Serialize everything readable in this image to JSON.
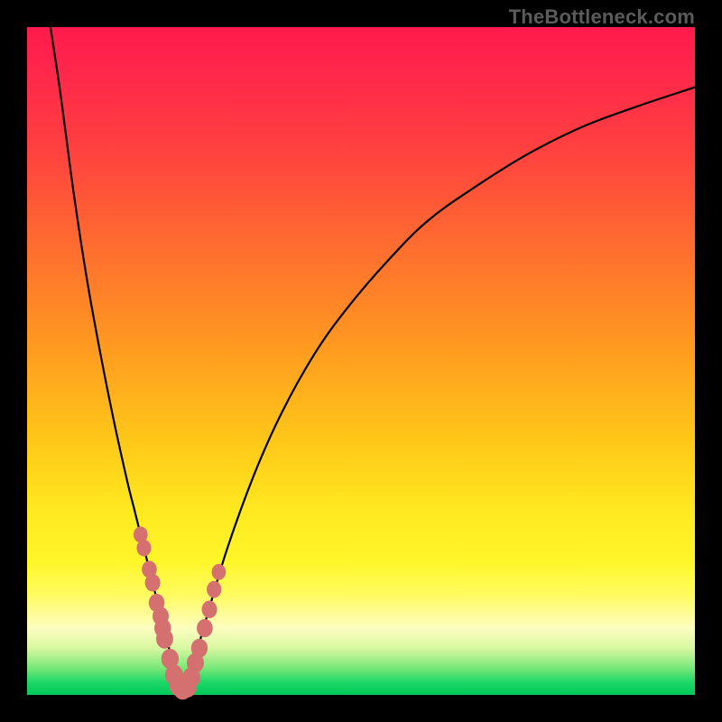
{
  "watermark": "TheBottleneck.com",
  "colors": {
    "background": "#000000",
    "curve": "#000000",
    "bead": "#d47070",
    "gradient_top": "#ff1a4d",
    "gradient_bottom": "#00c85a"
  },
  "chart_data": {
    "type": "line",
    "title": "",
    "xlabel": "",
    "ylabel": "",
    "xlim": [
      0,
      100
    ],
    "ylim": [
      0,
      100
    ],
    "grid": false,
    "series": [
      {
        "name": "left-curve",
        "x": [
          3.5,
          5,
          7,
          9,
          11,
          13,
          15,
          16,
          17,
          18,
          19,
          20,
          21,
          22,
          22.8
        ],
        "y": [
          100,
          90,
          75,
          62,
          51,
          41,
          32,
          28,
          24,
          20,
          16,
          12,
          8,
          4,
          0.9
        ]
      },
      {
        "name": "right-curve",
        "x": [
          23.8,
          25,
          27,
          30,
          34,
          38,
          43,
          48,
          54,
          60,
          67,
          75,
          83,
          91,
          100
        ],
        "y": [
          1.2,
          5,
          12,
          22,
          33,
          42,
          51,
          58,
          65,
          71,
          76,
          81,
          85,
          88,
          91
        ]
      }
    ],
    "markers": [
      {
        "series": "left-curve",
        "index_range": [
          7,
          14
        ]
      },
      {
        "series": "right-curve",
        "index_range": [
          0,
          4
        ]
      }
    ],
    "beads": {
      "left": [
        [
          17.0,
          24.0
        ],
        [
          17.5,
          22.0
        ],
        [
          18.3,
          18.8
        ],
        [
          18.8,
          16.8
        ],
        [
          19.4,
          13.8
        ],
        [
          20.0,
          11.8
        ],
        [
          20.3,
          10.0
        ],
        [
          20.6,
          8.4
        ],
        [
          21.4,
          5.4
        ],
        [
          22.0,
          3.0
        ],
        [
          22.7,
          1.4
        ],
        [
          23.3,
          0.9
        ]
      ],
      "right": [
        [
          24.0,
          1.2
        ],
        [
          24.6,
          2.6
        ],
        [
          25.2,
          4.8
        ],
        [
          25.8,
          7.0
        ],
        [
          26.6,
          10.0
        ],
        [
          27.3,
          12.8
        ],
        [
          28.0,
          15.8
        ],
        [
          28.7,
          18.4
        ]
      ]
    }
  }
}
